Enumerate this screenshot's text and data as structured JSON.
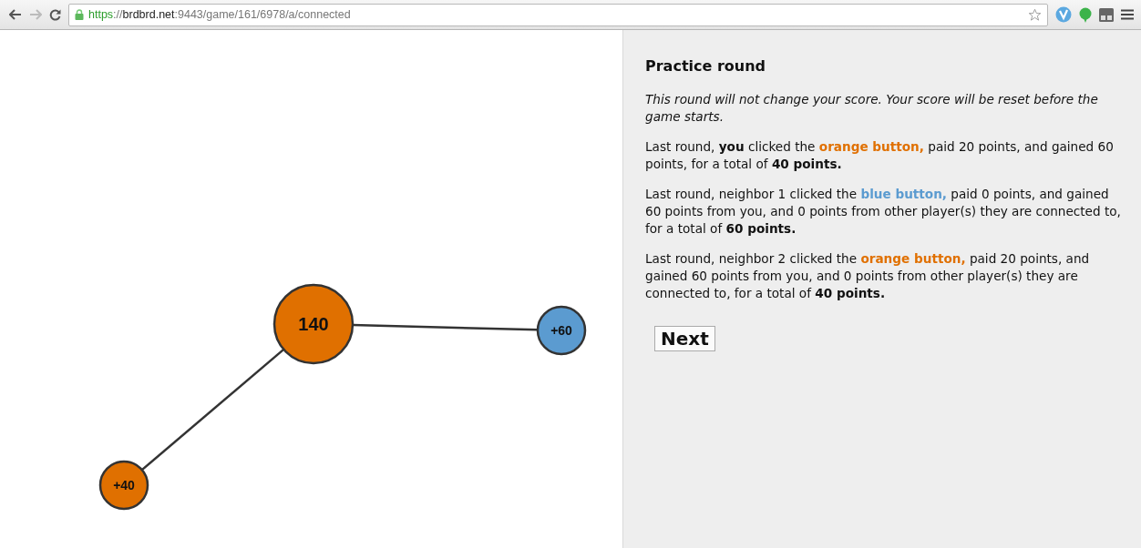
{
  "browser": {
    "url": {
      "scheme": "https",
      "separator": "://",
      "host": "brdbrd.net",
      "path": ":9443/game/161/6978/a/connected"
    }
  },
  "network": {
    "nodes": [
      {
        "label": "140",
        "color": "#e07000",
        "kind": "center"
      },
      {
        "label": "+60",
        "color": "#5b9bd0",
        "kind": "neighbor"
      },
      {
        "label": "+40",
        "color": "#e07000",
        "kind": "neighbor"
      }
    ]
  },
  "panel": {
    "title": "Practice round",
    "note": "This round will not change your score. Your score will be reset before the game starts.",
    "paragraphs": [
      [
        {
          "kind": "text",
          "text": "Last round, "
        },
        {
          "kind": "bold",
          "text": "you"
        },
        {
          "kind": "text",
          "text": " clicked the "
        },
        {
          "kind": "highlight",
          "color": "#e07000",
          "text": "orange button,"
        },
        {
          "kind": "text",
          "text": " paid 20 points, and gained 60 points, for a total of "
        },
        {
          "kind": "bold",
          "text": "40 points."
        }
      ],
      [
        {
          "kind": "text",
          "text": "Last round, neighbor 1 clicked the "
        },
        {
          "kind": "highlight",
          "color": "#5b9bd0",
          "text": "blue button,"
        },
        {
          "kind": "text",
          "text": " paid 0 points, and gained 60 points from you, and 0 points from other player(s) they are connected to, for a total of "
        },
        {
          "kind": "bold",
          "text": "60 points."
        }
      ],
      [
        {
          "kind": "text",
          "text": "Last round, neighbor 2 clicked the "
        },
        {
          "kind": "highlight",
          "color": "#e07000",
          "text": "orange button,"
        },
        {
          "kind": "text",
          "text": " paid 20 points, and gained 60 points from you, and 0 points from other player(s) they are connected to, for a total of "
        },
        {
          "kind": "bold",
          "text": "40 points."
        }
      ]
    ],
    "button": "Next"
  }
}
